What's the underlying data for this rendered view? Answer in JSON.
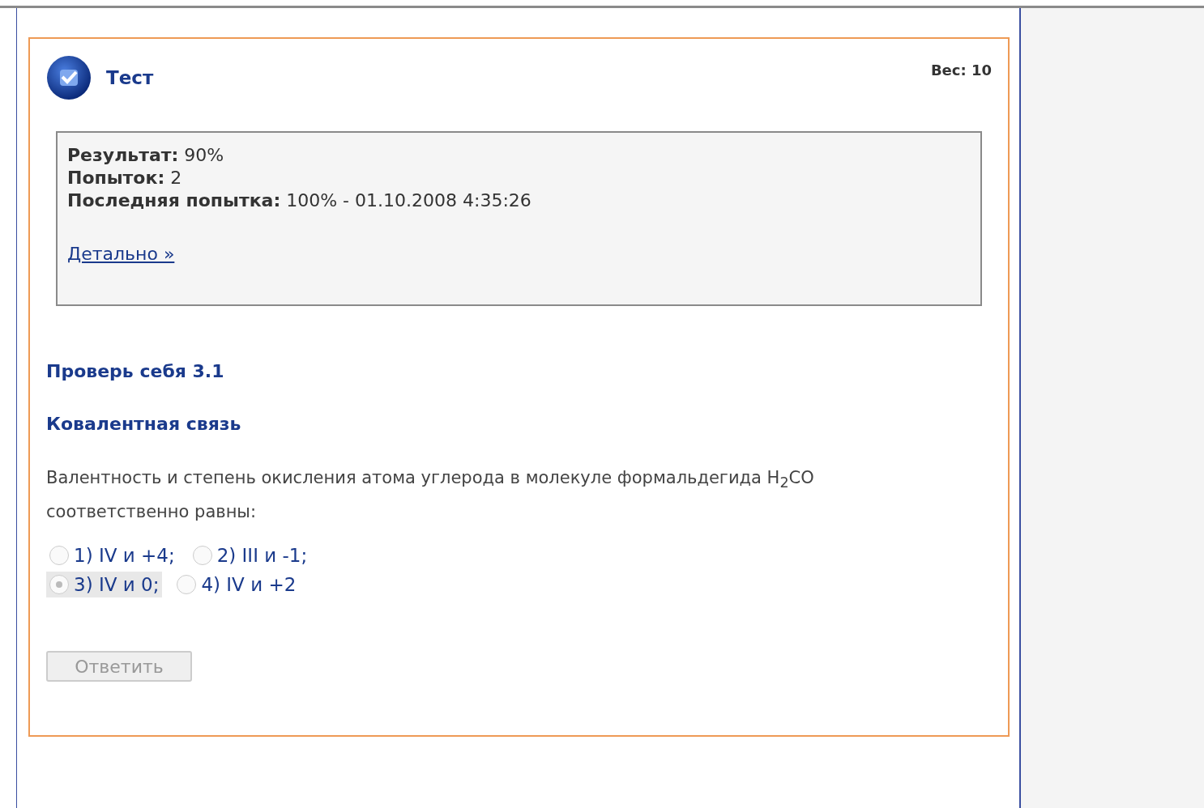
{
  "card": {
    "title": "Тест",
    "weight": "Вес: 10"
  },
  "summary": {
    "rows": [
      {
        "label": "Результат:",
        "value": "90%"
      },
      {
        "label": "Попыток:",
        "value": "2"
      },
      {
        "label": "Последняя попытка:",
        "value": "100% - 01.10.2008 4:35:26"
      }
    ],
    "link": "Детально »"
  },
  "section_title": "Проверь себя 3.1",
  "topic": "Ковалентная связь",
  "question": "Валентность и степень окисления атома углерода в молекуле формальдегида H$_{2}$CO соответственно равны:",
  "options": [
    [
      {
        "label": "1) IV и +4;",
        "selected": false
      },
      {
        "label": "2) III и -1;",
        "selected": false
      }
    ],
    [
      {
        "label": "3) IV и 0;",
        "selected": true
      },
      {
        "label": "4) IV и +2",
        "selected": false
      }
    ]
  ],
  "answer_button": {
    "label": "Ответить",
    "disabled": true
  }
}
